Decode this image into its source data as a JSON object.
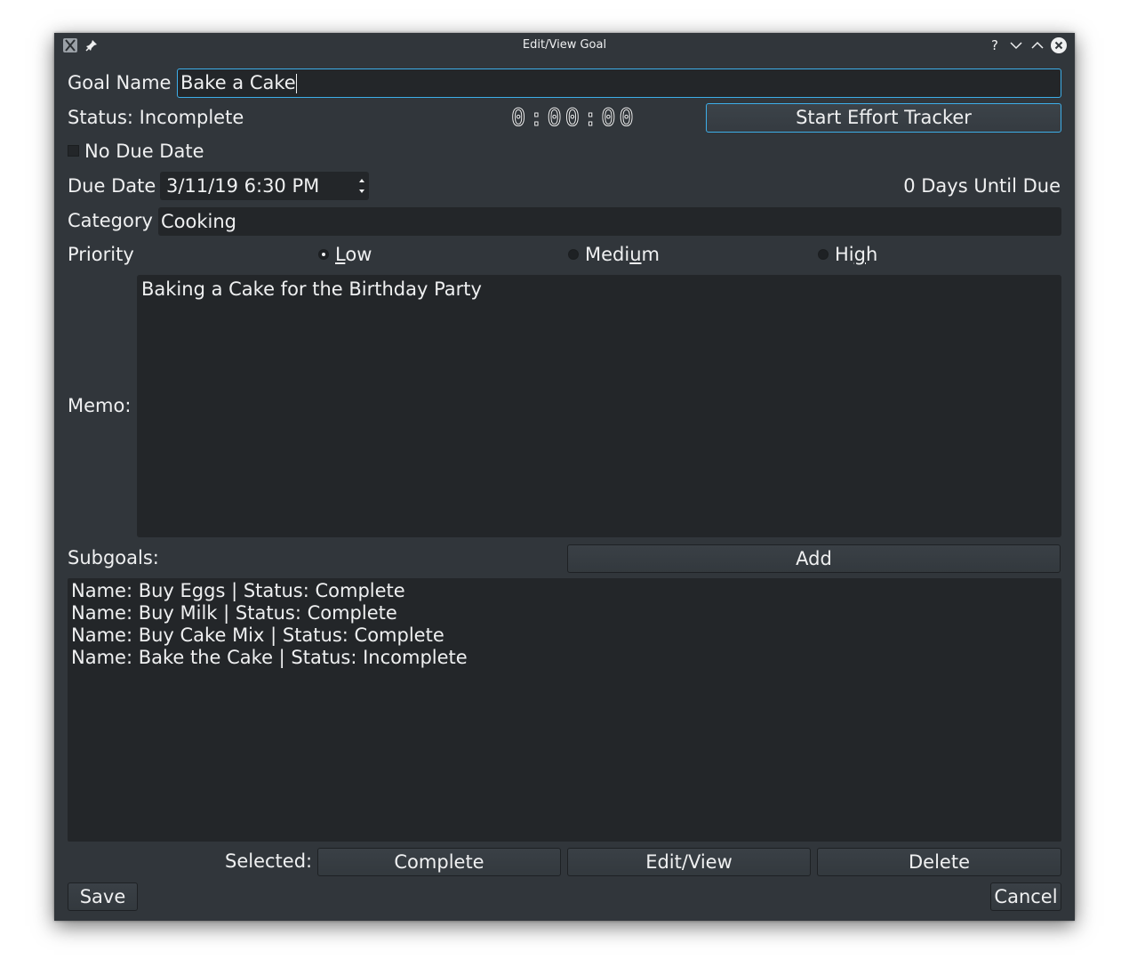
{
  "window": {
    "title": "Edit/View Goal"
  },
  "titlebar": {
    "help_label": "?"
  },
  "goal_name": {
    "label": "Goal Name",
    "value": "Bake a Cake"
  },
  "status": {
    "label": "Status: Incomplete"
  },
  "timer": {
    "display": "0:00:00"
  },
  "effort_tracker": {
    "button_label": "Start Effort Tracker"
  },
  "no_due_date": {
    "label": "No Due Date",
    "checked": false
  },
  "due_date": {
    "label": "Due Date",
    "value": "3/11/19 6:30 PM",
    "days_until": "0 Days Until Due"
  },
  "category": {
    "label": "Category",
    "value": "Cooking"
  },
  "priority": {
    "label": "Priority",
    "options": [
      {
        "pre": "",
        "mnemonic": "L",
        "post": "ow",
        "checked": true
      },
      {
        "pre": "Medi",
        "mnemonic": "u",
        "post": "m",
        "checked": false
      },
      {
        "pre": "Hi",
        "mnemonic": "g",
        "post": "h",
        "checked": false
      }
    ]
  },
  "memo": {
    "label": "Memo:",
    "value": "Baking a Cake for the Birthday Party"
  },
  "subgoals": {
    "label": "Subgoals:",
    "add_label": "Add",
    "items": [
      "Name: Buy Eggs | Status: Complete",
      "Name: Buy Milk | Status: Complete",
      "Name: Buy Cake Mix | Status: Complete",
      "Name: Bake the Cake | Status: Incomplete"
    ],
    "selected_label": "Selected:",
    "complete_label": "Complete",
    "editview_label": "Edit/View",
    "delete_label": "Delete"
  },
  "footer": {
    "save_label": "Save",
    "cancel_label": "Cancel"
  },
  "colors": {
    "window_bg": "#31363b",
    "field_bg": "#232629",
    "text": "#eff0f1",
    "focus_border": "#3daee9"
  },
  "icons": {
    "app": "x-app-icon",
    "pin": "pin-icon",
    "minimize": "chevron-down-icon",
    "maximize": "chevron-up-icon",
    "close": "close-icon"
  }
}
